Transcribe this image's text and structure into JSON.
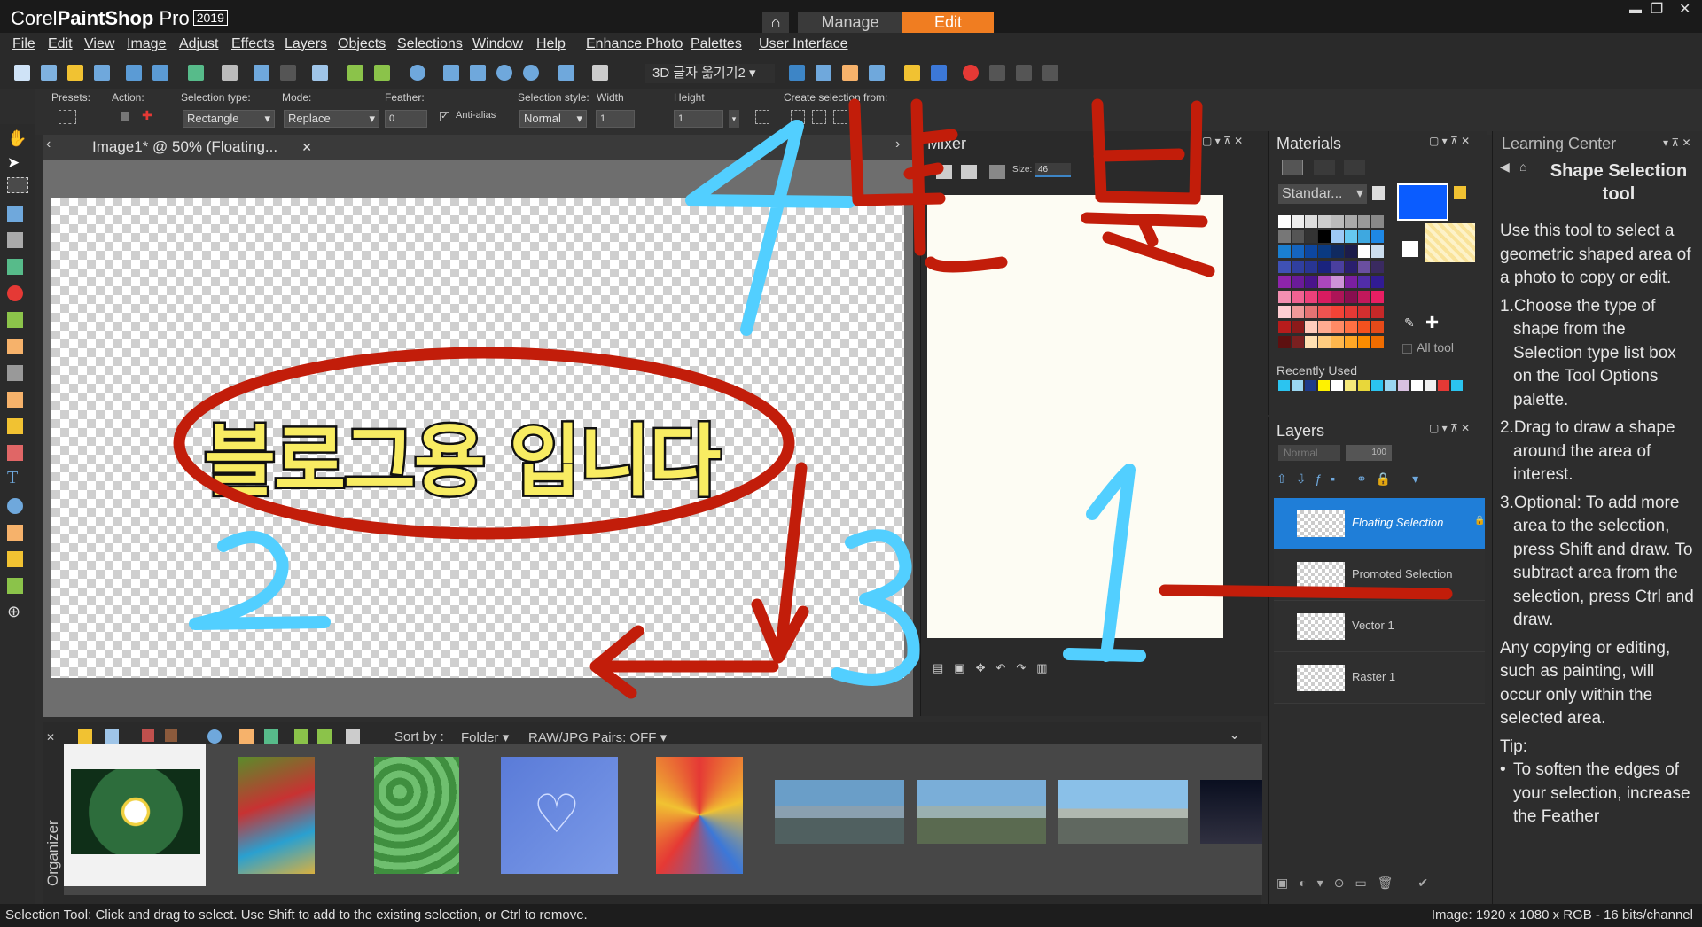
{
  "app": {
    "brand": "Corel",
    "product": "PaintShop",
    "product_suffix": "Pro",
    "year": "2019",
    "tabs": {
      "home": "⌂",
      "manage": "Manage",
      "edit": "Edit"
    }
  },
  "menu": [
    "File",
    "Edit",
    "View",
    "Image",
    "Adjust",
    "Effects",
    "Layers",
    "Objects",
    "Selections",
    "Window",
    "Help",
    "Enhance Photo",
    "Palettes",
    "User Interface"
  ],
  "toolbar": {
    "script_name": "3D 글자 옮기기2"
  },
  "options": {
    "presets_label": "Presets:",
    "action_label": "Action:",
    "selection_type_label": "Selection type:",
    "selection_type_value": "Rectangle",
    "mode_label": "Mode:",
    "mode_value": "Replace",
    "feather_label": "Feather:",
    "feather_value": "0",
    "antialias_label": "Anti-alias",
    "style_label": "Selection style:",
    "style_value": "Normal",
    "width_label": "Width",
    "width_value": "1",
    "height_label": "Height",
    "height_value": "1",
    "create_from_label": "Create selection from:"
  },
  "document": {
    "tab_title": "Image1* @  50% (Floating..."
  },
  "canvas": {
    "text": "블로그용 입니다"
  },
  "annotations": {
    "n1": "1",
    "n2": "2",
    "n3": "3",
    "n4": "4",
    "korean": "반 복"
  },
  "mixer": {
    "title": "Mixer",
    "size_label": "Size:",
    "size_value": "46"
  },
  "materials": {
    "title": "Materials",
    "palette": "Standar...",
    "all_tools": "All tool",
    "recent": "Recently Used",
    "fg_color": "#0a5cff"
  },
  "layers": {
    "title": "Layers",
    "blend": "Normal",
    "opacity": "100",
    "rows": [
      {
        "name": "Floating Selection",
        "selected": true
      },
      {
        "name": "Promoted Selection",
        "selected": false
      },
      {
        "name": "Vector 1",
        "selected": false
      },
      {
        "name": "Raster 1",
        "selected": false
      }
    ]
  },
  "learning": {
    "title": "Learning Center",
    "heading": "Shape Selection tool",
    "intro": "Use this tool to select a geometric shaped area of a photo to copy or edit.",
    "steps": [
      "1.Choose the type of shape from the Selection type list box on the Tool Options palette.",
      "2.Drag to draw a shape around the area of interest.",
      "3.Optional: To add more area to the selection, press Shift and draw. To subtract area from the selection, press Ctrl and draw."
    ],
    "note": "Any copying or editing, such as painting, will occur only within the selected area.",
    "tip_label": "Tip:",
    "tip": "To soften the edges of your selection, increase the Feather"
  },
  "organizer": {
    "label": "Organizer",
    "sort_label": "Sort by :",
    "sort_value": "Folder",
    "raw_pairs": "RAW/JPG Pairs: OFF"
  },
  "status": {
    "left": "Selection Tool: Click and drag to select. Use Shift to add to the existing selection, or Ctrl to remove.",
    "right": "Image:  1920 x 1080 x RGB - 16 bits/channel"
  }
}
